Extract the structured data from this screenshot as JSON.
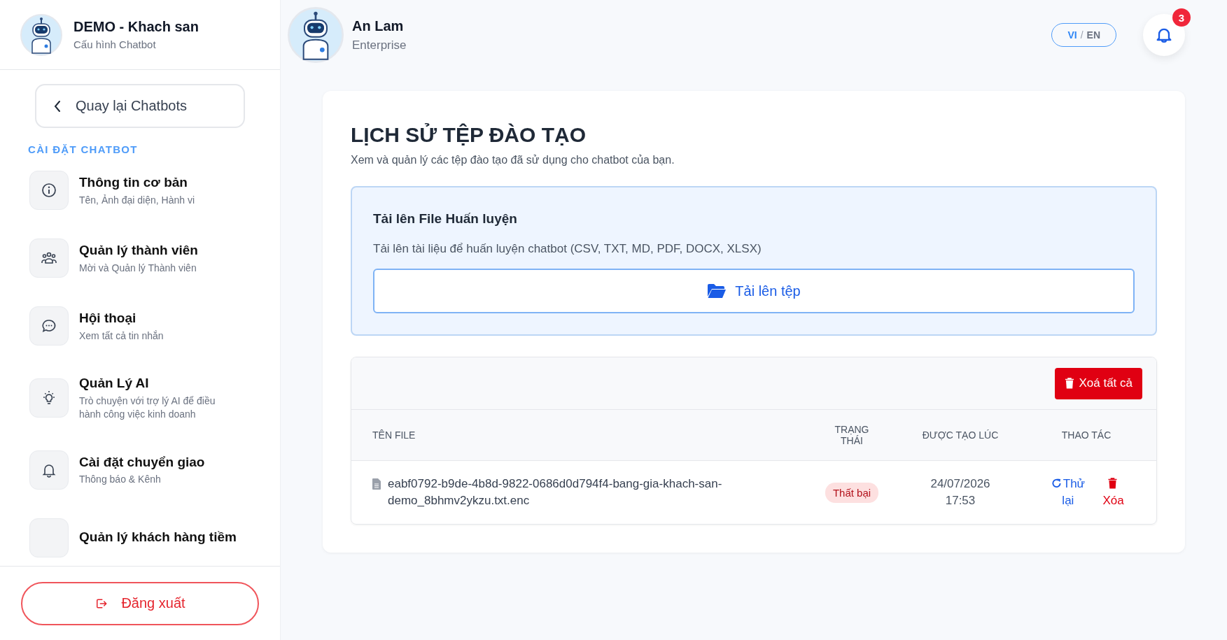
{
  "sidebar": {
    "bot_name": "DEMO - Khach san",
    "bot_subtitle": "Cấu hình Chatbot",
    "back_button": "Quay lại Chatbots",
    "section_label": "CÀI ĐẶT CHATBOT",
    "items": [
      {
        "kind": "info",
        "title": "Thông tin cơ bản",
        "subtitle": "Tên, Ảnh đại diện, Hành vi"
      },
      {
        "kind": "users",
        "title": "Quản lý thành viên",
        "subtitle": "Mời và Quản lý Thành viên"
      },
      {
        "kind": "chat",
        "title": "Hội thoại",
        "subtitle": "Xem tất cả tin nhắn"
      },
      {
        "kind": "bulb",
        "title": "Quản Lý AI",
        "subtitle": "Trò chuyện với trợ lý AI để điều hành công việc kinh doanh"
      },
      {
        "kind": "bell",
        "title": "Cài đặt chuyển giao",
        "subtitle": "Thông báo & Kênh"
      },
      {
        "kind": "none",
        "title": "Quản lý khách hàng tiềm"
      }
    ],
    "logout_button": "Đăng xuất"
  },
  "header": {
    "user_name": "An Lam",
    "plan": "Enterprise",
    "languages": [
      {
        "label": "VI",
        "selected": true
      },
      {
        "label": "EN",
        "selected": false
      }
    ],
    "language_separator": "/",
    "notification_count": "3"
  },
  "page": {
    "title": "LỊCH SỬ TỆP ĐÀO TẠO",
    "description": "Xem và quản lý các tệp đào tạo đã sử dụng cho chatbot của bạn.",
    "upload": {
      "title": "Tải lên File Huấn luyện",
      "description": "Tải lên tài liệu để huấn luyện chatbot (CSV, TXT, MD, PDF, DOCX, XLSX)",
      "button": "Tải lên tệp"
    },
    "table": {
      "delete_all_button": "Xoá tất cả",
      "columns": [
        "TÊN FILE",
        "TRẠNG THÁI",
        "ĐƯỢC TẠO LÚC",
        "THAO TÁC"
      ],
      "rows": [
        {
          "file_name": "eabf0792-b9de-4b8d-9822-0686d0d794f4-bang-gia-khach-san-demo_8bhmv2ykzu.txt.enc",
          "status": "Thất bại",
          "kind": "failed",
          "created": "24/07/2026 17:53",
          "retry": "Thử lại",
          "delete": "Xóa"
        }
      ]
    }
  }
}
